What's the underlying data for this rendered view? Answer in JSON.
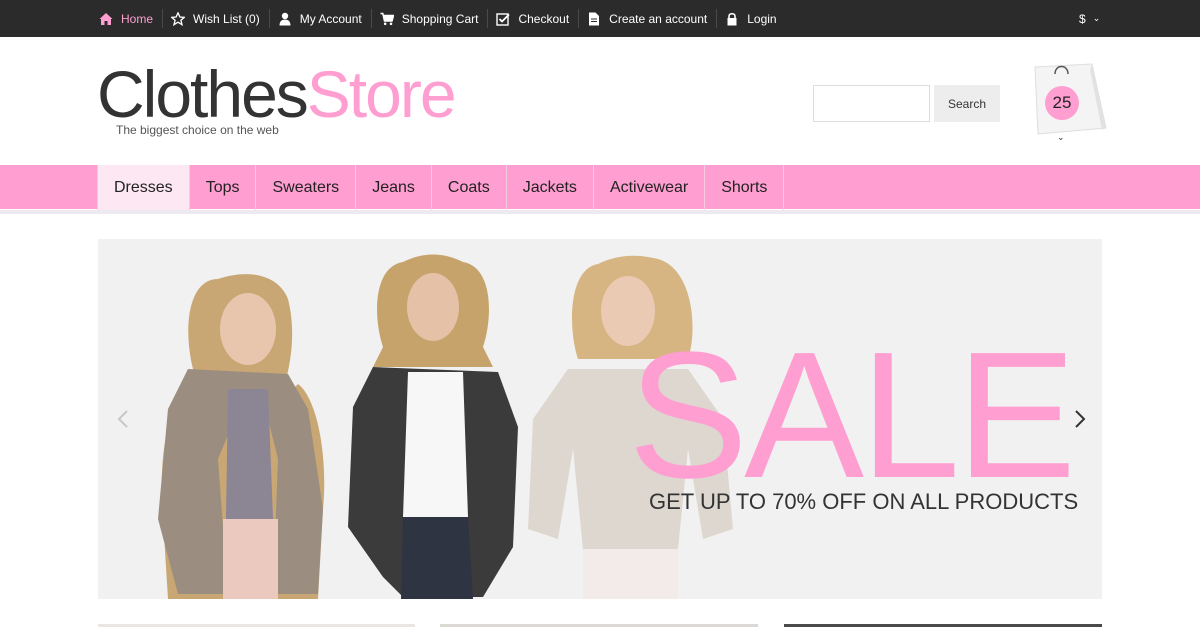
{
  "topbar": {
    "links": [
      {
        "label": "Home",
        "icon": "home-icon"
      },
      {
        "label": "Wish List (0)",
        "icon": "star-icon"
      },
      {
        "label": "My Account",
        "icon": "user-icon"
      },
      {
        "label": "Shopping Cart",
        "icon": "cart-icon"
      },
      {
        "label": "Checkout",
        "icon": "checkout-icon"
      },
      {
        "label": "Create an account",
        "icon": "document-icon"
      },
      {
        "label": "Login",
        "icon": "lock-icon"
      }
    ],
    "currency": "$"
  },
  "header": {
    "logo_part1": "Clothes",
    "logo_part2": "Store",
    "tagline": "The biggest choice on the web",
    "search": {
      "placeholder": "",
      "value": "",
      "button": "Search"
    },
    "cart_count": "25"
  },
  "menu": {
    "items": [
      "Dresses",
      "Tops",
      "Sweaters",
      "Jeans",
      "Coats",
      "Jackets",
      "Activewear",
      "Shorts"
    ],
    "active": "Dresses"
  },
  "banner": {
    "headline": "SALE",
    "subline": "GET UP TO 70% OFF ON ALL PRODUCTS"
  },
  "colors": {
    "accent": "#ff9ed0",
    "topbar": "#2b2b2b",
    "text": "#333333"
  }
}
